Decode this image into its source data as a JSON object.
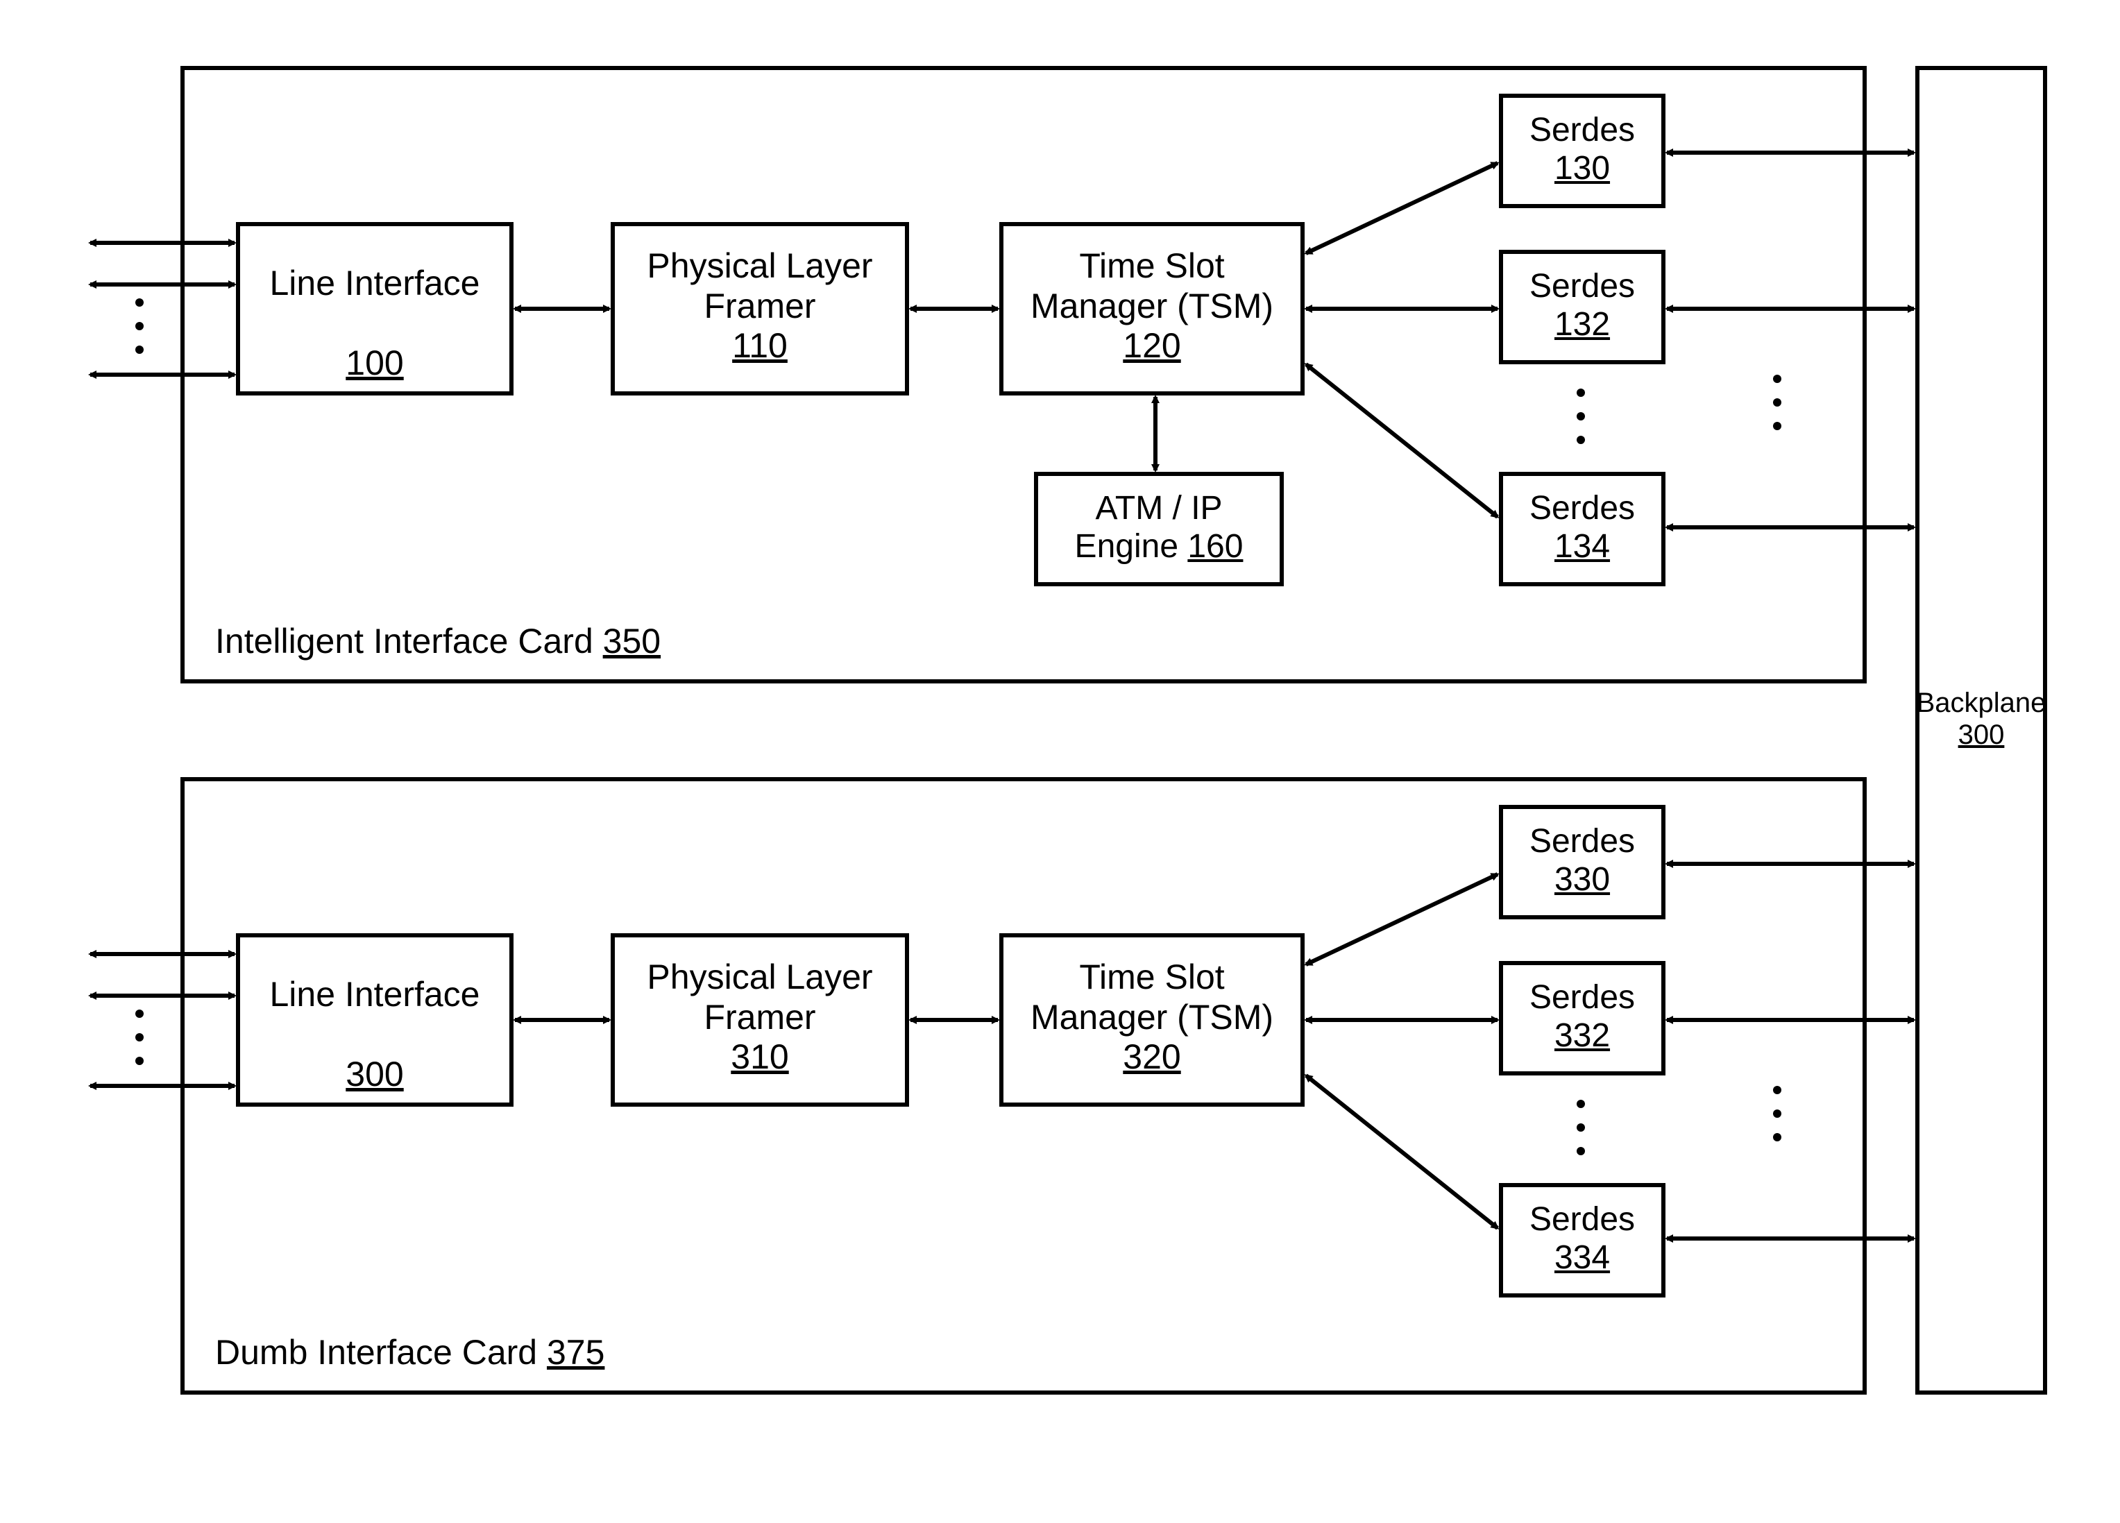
{
  "card1": {
    "title_prefix": "Intelligent Interface Card ",
    "title_ref": "350",
    "line_interface": {
      "label": "Line Interface",
      "ref": "100"
    },
    "framer": {
      "label_l1": "Physical Layer",
      "label_l2": "Framer",
      "ref": "110"
    },
    "tsm": {
      "label_l1": "Time Slot",
      "label_l2": "Manager (TSM)",
      "ref": "120"
    },
    "engine": {
      "label_l1": "ATM / IP",
      "label_l2": "Engine ",
      "ref": "160"
    },
    "serdes": [
      {
        "label": "Serdes",
        "ref": "130"
      },
      {
        "label": "Serdes",
        "ref": "132"
      },
      {
        "label": "Serdes",
        "ref": "134"
      }
    ]
  },
  "card2": {
    "title_prefix": "Dumb Interface Card ",
    "title_ref": "375",
    "line_interface": {
      "label": "Line Interface",
      "ref": "300"
    },
    "framer": {
      "label_l1": "Physical Layer",
      "label_l2": "Framer",
      "ref": "310"
    },
    "tsm": {
      "label_l1": "Time Slot",
      "label_l2": "Manager (TSM)",
      "ref": "320"
    },
    "serdes": [
      {
        "label": "Serdes",
        "ref": "330"
      },
      {
        "label": "Serdes",
        "ref": "332"
      },
      {
        "label": "Serdes",
        "ref": "334"
      }
    ]
  },
  "backplane": {
    "label": "Backplane",
    "ref": "300"
  }
}
